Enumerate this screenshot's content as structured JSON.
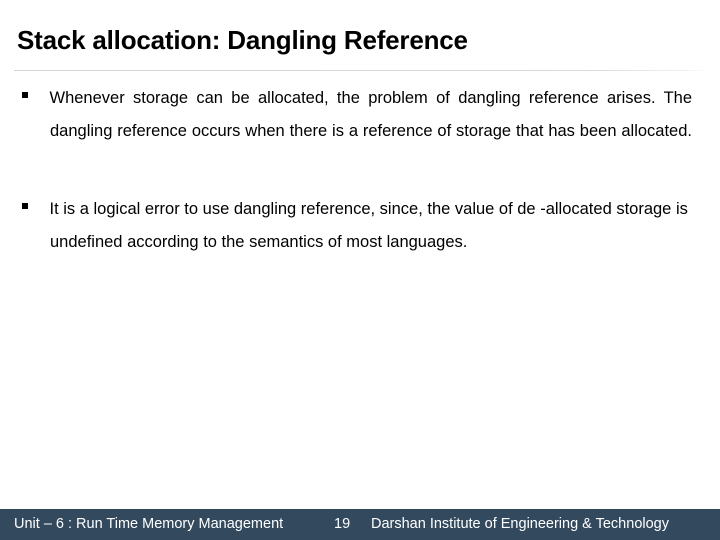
{
  "slide": {
    "title": "Stack allocation: Dangling Reference",
    "background_color": "#ffffff",
    "text_color": "#000000",
    "divider_color": "#d9d9d9",
    "bullets": [
      {
        "marker": "square-bullet",
        "text": "Whenever storage can be allocated, the problem of dangling reference arises. The dangling reference occurs when there is a reference of storage that has been allocated.",
        "alignment": "justify"
      },
      {
        "marker": "square-bullet",
        "text": "It is a logical error to use dangling reference, since, the value of de -allocated storage is undefined according to the semantics of most languages.",
        "alignment": "left"
      }
    ]
  },
  "footer": {
    "background_color": "#33495e",
    "text_color": "#ffffff",
    "unit_label": "Unit – 6 : Run Time Memory Management",
    "page_number": "19",
    "organization": "Darshan Institute of Engineering & Technology"
  }
}
